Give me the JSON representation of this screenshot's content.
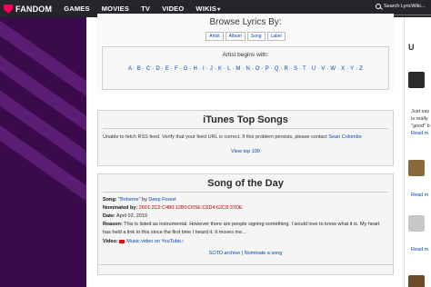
{
  "nav": {
    "brand": "FANDOM",
    "links": [
      "GAMES",
      "MOVIES",
      "TV",
      "VIDEO",
      "WIKIS"
    ],
    "wikis_caret": "▾",
    "search_placeholder": "Search LyricWiki..."
  },
  "browse": {
    "title": "Browse Lyrics By:",
    "tabs": [
      "Artist",
      "Album",
      "Song",
      "Label"
    ],
    "begins_label": "Artist begins with:",
    "letters": "A · B · C · D · E · F · G · H · I · J · K · L · M · N · O · P · Q · R · S · T · U · V · W · X · Y · Z"
  },
  "itunes": {
    "title": "iTunes Top Songs",
    "message": "Unable to fetch RSS feed. Verify that your feed URL is correct. If this problem persists, please contact",
    "contact_name": "Sean Colombo",
    "view_link": "View top 100"
  },
  "sotd": {
    "title": "Song of the Day",
    "song_label": "Song:",
    "song_name": "\"Boheme\"",
    "by": "by",
    "artist": "Deep Forest",
    "nominated_label": "Nominated by:",
    "nominator": "2601:2C2:C480:12B0:D05E:C6D4:62C8:37DE",
    "date_label": "Date:",
    "date": "April 02, 2019",
    "reason_label": "Reason:",
    "reason": "This is listed as instrumental. However there are people signing something. I would love to know what it is. My heart has held a link to this since the first time I heard it. It moves me...",
    "video_label": "Video:",
    "video_link": "Music video on YouTube",
    "archive_link": "SOTD archive",
    "separator": "|",
    "nominate_link": "Nominate a song"
  },
  "rail": {
    "heading": "U",
    "snippet_lines": [
      "Just sav",
      "is really",
      "\"good\" b",
      "Read m"
    ],
    "read_more": "Read m"
  },
  "colors": {
    "nav_bg": "#24262a",
    "brand_accent": "#fa005a",
    "side_bg": "#3a0a4a",
    "link": "#0645ad",
    "nominator": "#ba0000"
  }
}
